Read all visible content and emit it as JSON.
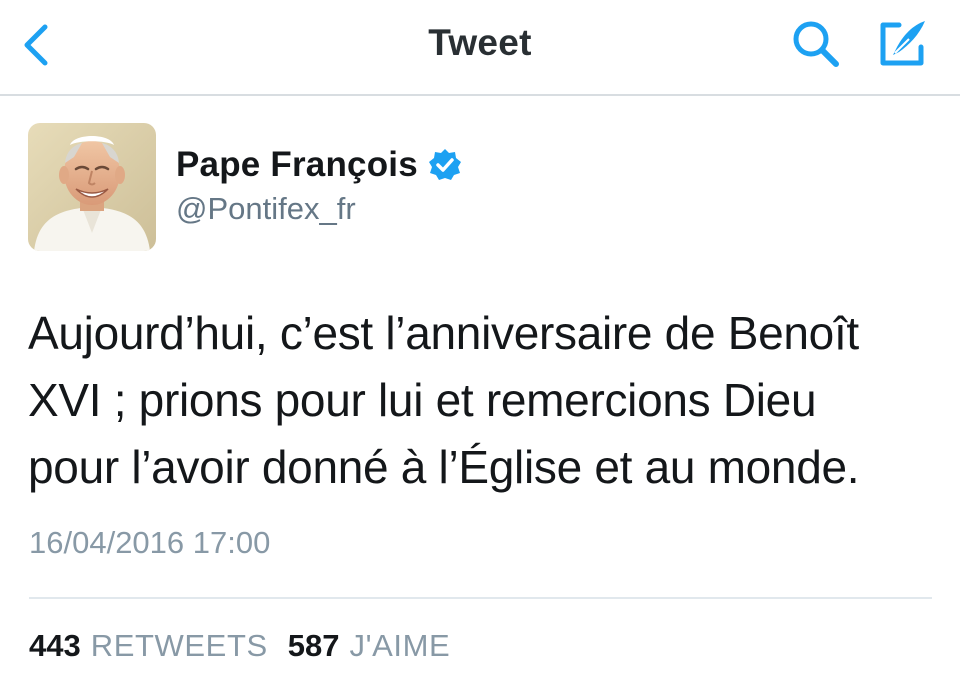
{
  "nav": {
    "title": "Tweet",
    "back_icon": "chevron-left-icon",
    "search_icon": "search-icon",
    "compose_icon": "compose-tweet-icon",
    "accent_color": "#1da1f2"
  },
  "tweet": {
    "author": {
      "name": "Pape François",
      "handle": "@Pontifex_fr",
      "verified": true,
      "verified_icon": "verified-badge-icon",
      "avatar_icon": "avatar"
    },
    "text_lines": [
      "Aujourd’hui, c’est l’anniversaire de Benoît",
      "XVI ; prions pour lui et remercions Dieu",
      "pour l’avoir donné à l’Église et au monde."
    ],
    "timestamp": "16/04/2016 17:00",
    "stats": {
      "retweets_count": "443",
      "retweets_label": "RETWEETS",
      "likes_count": "587",
      "likes_label": "J'AIME"
    }
  }
}
